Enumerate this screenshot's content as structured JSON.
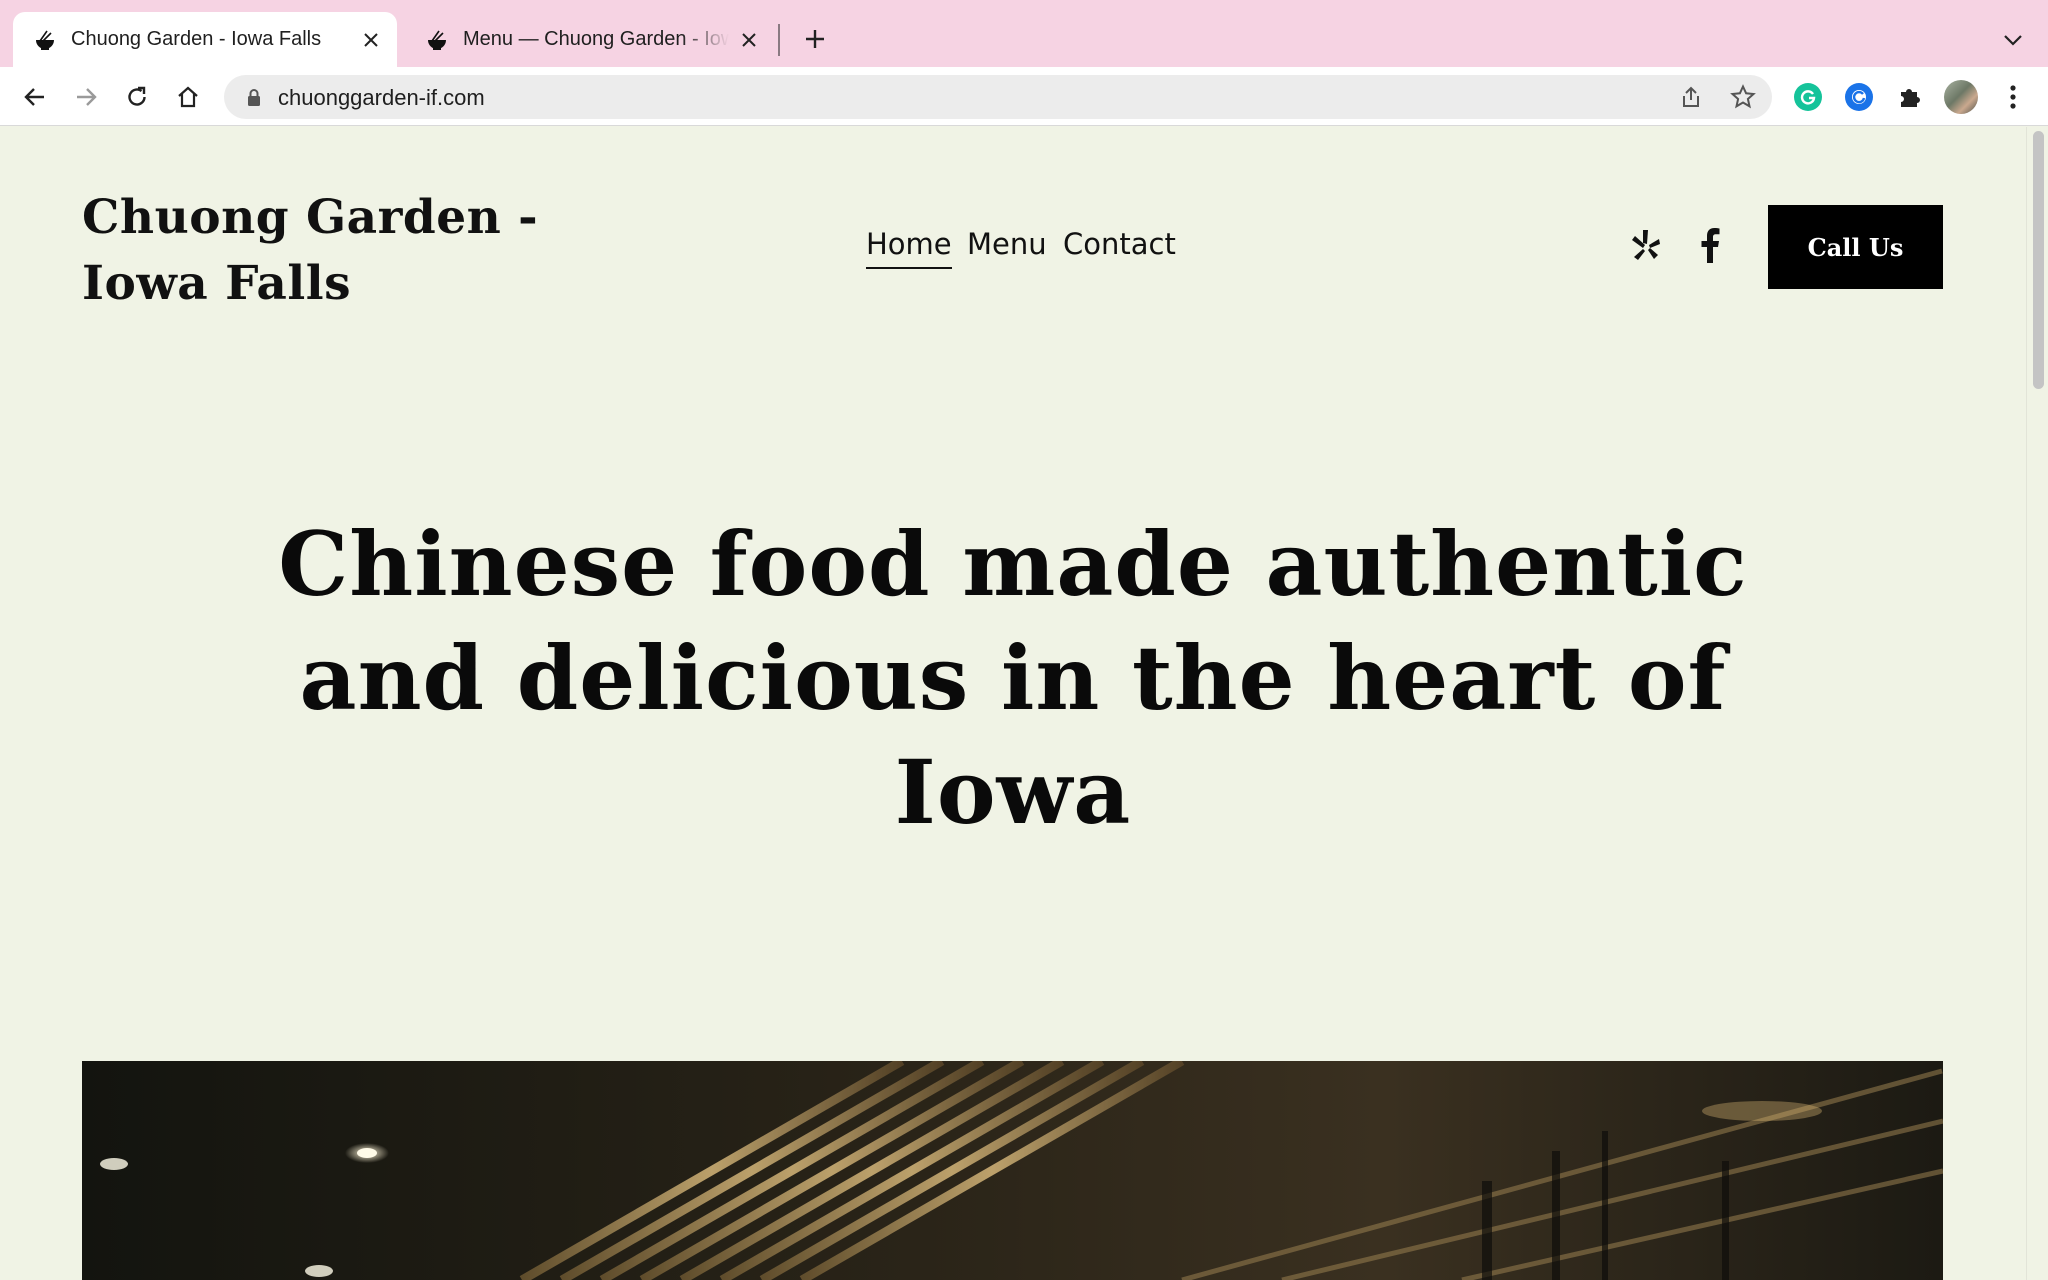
{
  "browser": {
    "tabs": [
      {
        "title": "Chuong Garden - Iowa Falls",
        "active": true
      },
      {
        "title": "Menu — Chuong Garden - Iowa Falls",
        "active": false
      }
    ],
    "url": "chuonggarden-if.com"
  },
  "site": {
    "title": "Chuong Garden - Iowa Falls",
    "nav": {
      "home": "Home",
      "menu": "Menu",
      "contact": "Contact",
      "active": "Home"
    },
    "social_icons": [
      "yelp-icon",
      "facebook-icon"
    ],
    "cta_label": "Call Us"
  },
  "hero": {
    "heading": "Chinese food made authentic and delicious in the heart of Iowa"
  },
  "colors": {
    "page_background": "#f0f3e5",
    "tabstrip_background": "#f6d3e3",
    "cta_background": "#000000",
    "text": "#111111"
  }
}
